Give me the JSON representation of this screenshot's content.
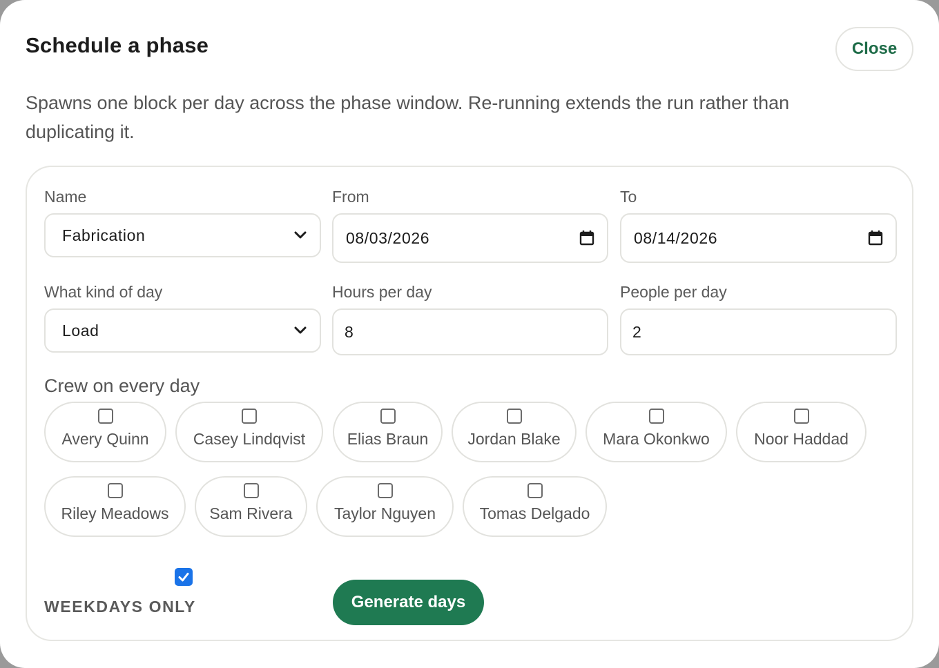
{
  "modal": {
    "title": "Schedule a phase",
    "close_label": "Close",
    "description": "Spawns one block per day across the phase window. Re-running extends the run rather than duplicating it."
  },
  "form": {
    "name": {
      "label": "Name",
      "value": "Fabrication"
    },
    "from": {
      "label": "From",
      "value": "08/03/2026"
    },
    "to": {
      "label": "To",
      "value": "08/14/2026"
    },
    "day_kind": {
      "label": "What kind of day",
      "value": "Load"
    },
    "hours": {
      "label": "Hours per day",
      "value": "8"
    },
    "people": {
      "label": "People per day",
      "value": "2"
    }
  },
  "crew": {
    "label": "Crew on every day",
    "members": [
      {
        "name": "Avery Quinn",
        "checked": false
      },
      {
        "name": "Casey Lindqvist",
        "checked": false
      },
      {
        "name": "Elias Braun",
        "checked": false
      },
      {
        "name": "Jordan Blake",
        "checked": false
      },
      {
        "name": "Mara Okonkwo",
        "checked": false
      },
      {
        "name": "Noor Haddad",
        "checked": false
      },
      {
        "name": "Riley Meadows",
        "checked": false
      },
      {
        "name": "Sam Rivera",
        "checked": false
      },
      {
        "name": "Taylor Nguyen",
        "checked": false
      },
      {
        "name": "Tomas Delgado",
        "checked": false
      }
    ]
  },
  "weekdays_only": {
    "label": "WEEKDAYS ONLY",
    "checked": true
  },
  "generate_label": "Generate days",
  "colors": {
    "accent": "#1f7a52",
    "close_text": "#1d6b47",
    "checkbox_checked": "#1a73e8"
  }
}
